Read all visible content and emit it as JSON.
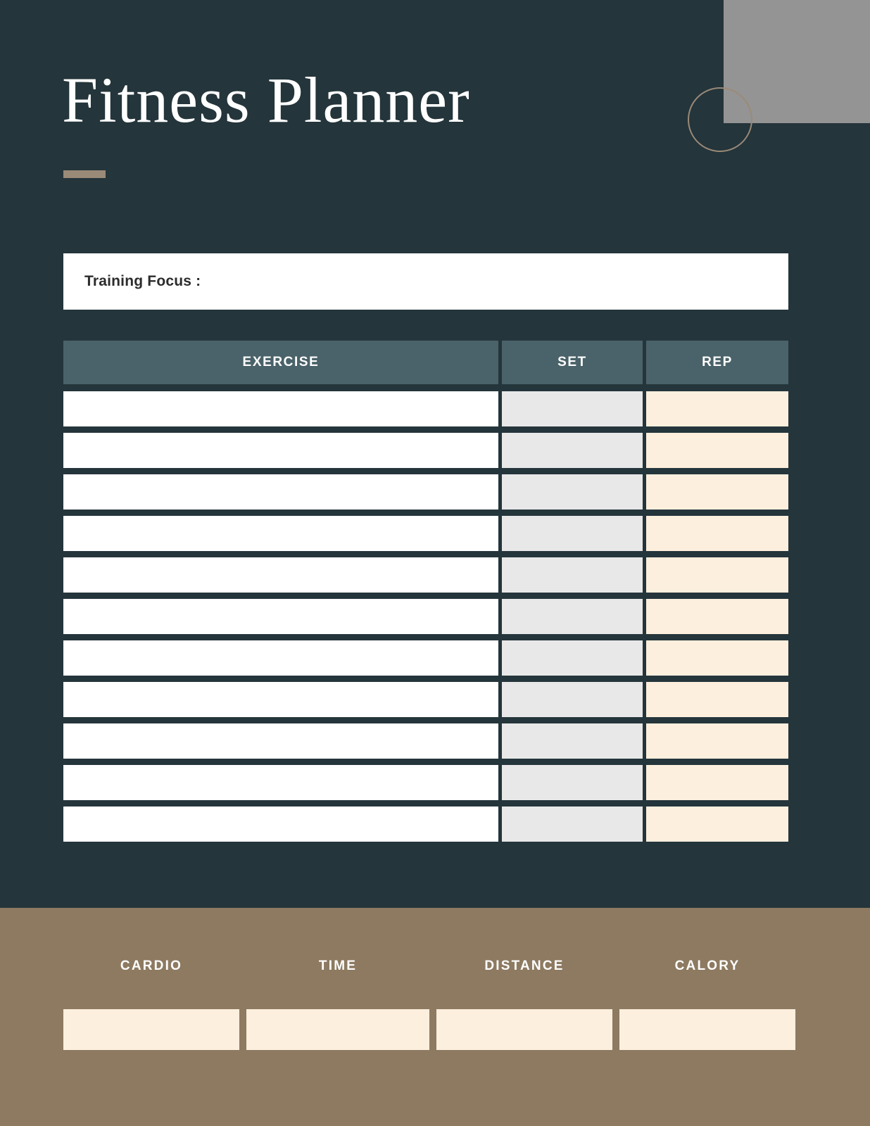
{
  "page": {
    "title": "Fitness Planner",
    "background_color": "#24353b",
    "accent_color": "#9a8a78",
    "header_cell_color": "#4a6269",
    "band_color": "#8d7a61",
    "cream_color": "#fcefdd",
    "set_cell_color": "#e8e8e8"
  },
  "decorations": {
    "corner_block_color": "#949494",
    "circle_outline_color": "#9a8a78"
  },
  "training_focus": {
    "label": "Training Focus :",
    "value": "",
    "placeholder": ""
  },
  "exercise_table": {
    "columns": [
      {
        "key": "exercise",
        "label": "EXERCISE"
      },
      {
        "key": "set",
        "label": "SET"
      },
      {
        "key": "rep",
        "label": "REP"
      }
    ],
    "rows": [
      {
        "exercise": "",
        "set": "",
        "rep": ""
      },
      {
        "exercise": "",
        "set": "",
        "rep": ""
      },
      {
        "exercise": "",
        "set": "",
        "rep": ""
      },
      {
        "exercise": "",
        "set": "",
        "rep": ""
      },
      {
        "exercise": "",
        "set": "",
        "rep": ""
      },
      {
        "exercise": "",
        "set": "",
        "rep": ""
      },
      {
        "exercise": "",
        "set": "",
        "rep": ""
      },
      {
        "exercise": "",
        "set": "",
        "rep": ""
      },
      {
        "exercise": "",
        "set": "",
        "rep": ""
      },
      {
        "exercise": "",
        "set": "",
        "rep": ""
      },
      {
        "exercise": "",
        "set": "",
        "rep": ""
      }
    ]
  },
  "cardio_section": {
    "fields": [
      {
        "key": "cardio",
        "label": "CARDIO",
        "value": ""
      },
      {
        "key": "time",
        "label": "TIME",
        "value": ""
      },
      {
        "key": "distance",
        "label": "DISTANCE",
        "value": ""
      },
      {
        "key": "calory",
        "label": "CALORY",
        "value": ""
      }
    ]
  }
}
